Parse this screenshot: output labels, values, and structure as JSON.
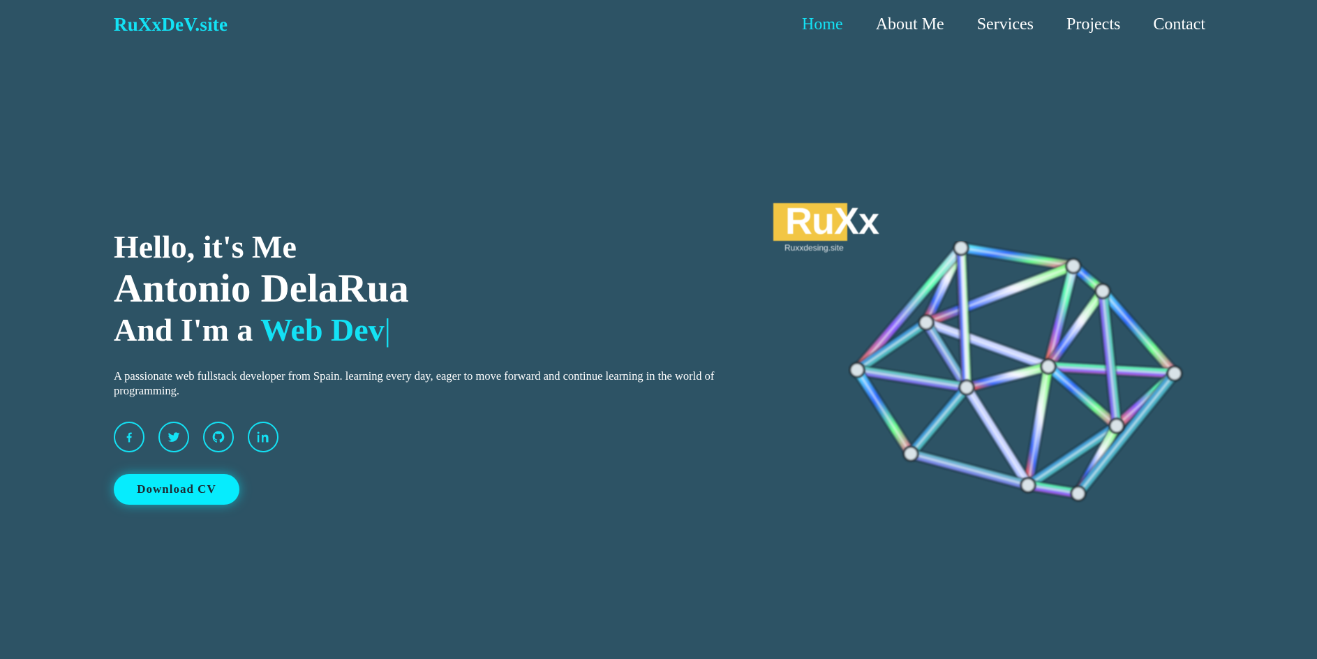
{
  "header": {
    "logo": "RuXxDeV.site",
    "nav": [
      {
        "label": "Home",
        "active": true
      },
      {
        "label": "About Me",
        "active": false
      },
      {
        "label": "Services",
        "active": false
      },
      {
        "label": "Projects",
        "active": false
      },
      {
        "label": "Contact",
        "active": false
      }
    ]
  },
  "hero": {
    "greeting": "Hello, it's Me",
    "name": "Antonio DelaRua",
    "role_prefix": "And I'm a ",
    "role_highlight": "Web Dev",
    "cursor": "|",
    "description": "A passionate web fullstack developer from Spain. learning every day, eager to move forward and continue learning in the world of programming.",
    "socials": [
      {
        "icon": "facebook-icon"
      },
      {
        "icon": "twitter-icon"
      },
      {
        "icon": "github-icon"
      },
      {
        "icon": "linkedin-icon"
      }
    ],
    "cv_button": "Download CV"
  },
  "brand": {
    "title": "RuXx",
    "subtitle": "Ruxxdesing.site"
  },
  "colors": {
    "background": "#2d5365",
    "accent": "#13e2f5",
    "button": "#06ecfd",
    "brand_yellow": "#f2c644"
  }
}
